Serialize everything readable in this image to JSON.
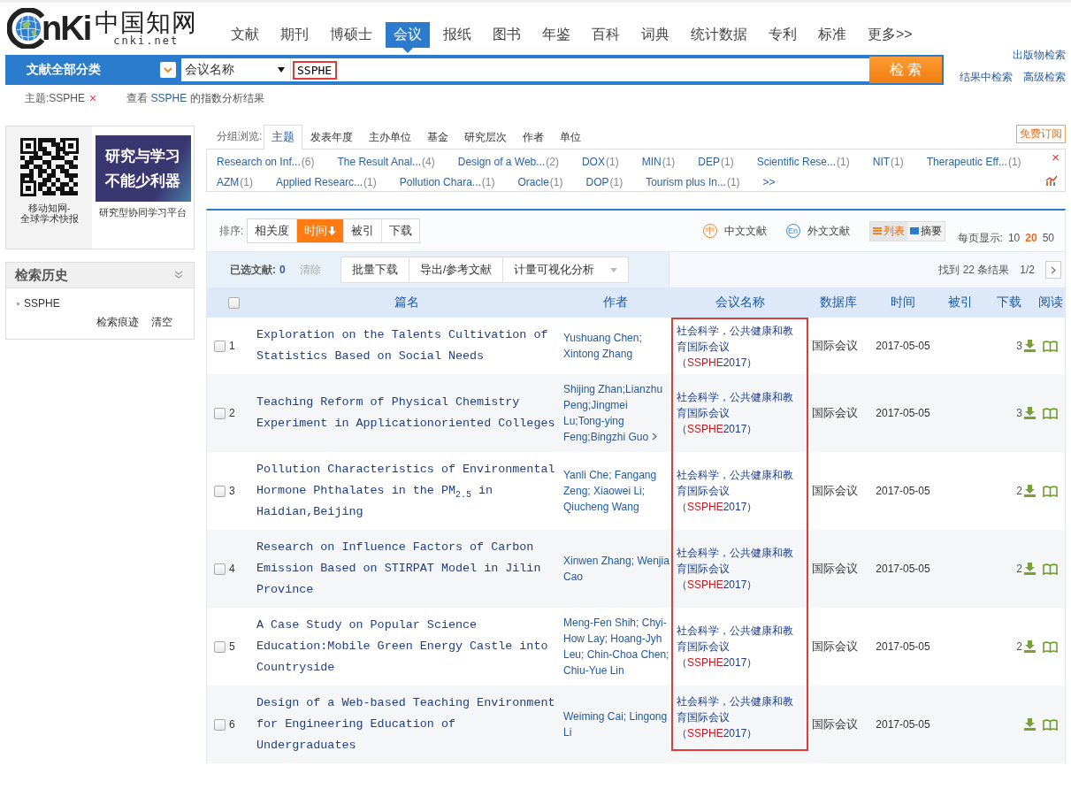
{
  "header": {
    "logo": {
      "mark": "nKi",
      "chinese": "中国知网",
      "domain": "cnki.net"
    },
    "nav": [
      {
        "label": "文献",
        "selected": false
      },
      {
        "label": "期刊",
        "selected": false
      },
      {
        "label": "博硕士",
        "selected": false
      },
      {
        "label": "会议",
        "selected": true
      },
      {
        "label": "报纸",
        "selected": false
      },
      {
        "label": "图书",
        "selected": false
      },
      {
        "label": "年鉴",
        "selected": false
      },
      {
        "label": "百科",
        "selected": false
      },
      {
        "label": "词典",
        "selected": false
      },
      {
        "label": "统计数据",
        "selected": false
      },
      {
        "label": "专利",
        "selected": false
      },
      {
        "label": "标准",
        "selected": false
      },
      {
        "label": "更多>>",
        "selected": false
      }
    ]
  },
  "search": {
    "category": "文献全部分类",
    "field": "会议名称",
    "query": "SSPHE",
    "query_highlighted": true,
    "button": "检 索",
    "links": [
      "出版物检索",
      "结果中检索",
      "高级检索"
    ]
  },
  "applied_filter": {
    "tag": "主题:SSPHE",
    "remove": "×",
    "analysis_prefix": "查看",
    "analysis_term": "SSPHE",
    "analysis_suffix": "的指数分析结果"
  },
  "sidebar": {
    "promo": {
      "qr_caption": [
        "移动知网-",
        "全球学术快报"
      ],
      "banner_lines": [
        "研究与学习",
        "不能少利器"
      ],
      "banner_caption": "研究型协同学习平台"
    },
    "history": {
      "title": "检索历史",
      "items": [
        "SSPHE"
      ],
      "actions": [
        "检索痕迹",
        "清空"
      ]
    }
  },
  "grouping": {
    "label": "分组浏览:",
    "tabs": [
      {
        "label": "主题",
        "selected": true
      },
      {
        "label": "发表年度",
        "selected": false
      },
      {
        "label": "主办单位",
        "selected": false
      },
      {
        "label": "基金",
        "selected": false
      },
      {
        "label": "研究层次",
        "selected": false
      },
      {
        "label": "作者",
        "selected": false
      },
      {
        "label": "单位",
        "selected": false
      }
    ],
    "subscribe": "免费订阅",
    "close": "×",
    "more": ">>",
    "items": [
      {
        "name": "Research on Inf...",
        "count": "(6)"
      },
      {
        "name": "The Result Anal...",
        "count": "(4)"
      },
      {
        "name": "Design of a Web...",
        "count": "(2)"
      },
      {
        "name": "DOX",
        "count": "(1)"
      },
      {
        "name": "MIN",
        "count": "(1)"
      },
      {
        "name": "DEP",
        "count": "(1)"
      },
      {
        "name": "Scientific Rese...",
        "count": "(1)"
      },
      {
        "name": "NIT",
        "count": "(1)"
      },
      {
        "name": "Therapeutic Eff...",
        "count": "(1)"
      },
      {
        "name": "AZM",
        "count": "(1)"
      },
      {
        "name": "Applied Researc...",
        "count": "(1)"
      },
      {
        "name": "Pollution Chara...",
        "count": "(1)"
      },
      {
        "name": "Oracle",
        "count": "(1)"
      },
      {
        "name": "DOP",
        "count": "(1)"
      },
      {
        "name": "Tourism plus In...",
        "count": "(1)"
      }
    ]
  },
  "results": {
    "sort": {
      "label": "排序:",
      "options": [
        {
          "label": "相关度",
          "selected": false
        },
        {
          "label": "时间",
          "selected": true
        },
        {
          "label": "被引",
          "selected": false
        },
        {
          "label": "下载",
          "selected": false
        }
      ]
    },
    "languages": [
      {
        "badge": "中",
        "label": "中文文献",
        "kind": "chinese"
      },
      {
        "badge": "En",
        "label": "外文文献",
        "kind": "foreign"
      }
    ],
    "views": [
      {
        "label": "列表",
        "selected": true,
        "kind": "list"
      },
      {
        "label": "摘要",
        "selected": false,
        "kind": "abstract"
      }
    ],
    "page_size": {
      "label": "每页显示:",
      "options": [
        {
          "label": "10",
          "selected": false
        },
        {
          "label": "20",
          "selected": true
        },
        {
          "label": "50",
          "selected": false
        }
      ]
    },
    "selection": {
      "label": "已选文献:",
      "count": "0",
      "clear": "清除",
      "actions": [
        {
          "label": "批量下载",
          "kind": "button"
        },
        {
          "label": "导出/参考文献",
          "kind": "button"
        },
        {
          "label": "计量可视化分析",
          "kind": "dropdown"
        }
      ]
    },
    "found": "找到 22 条结果",
    "page": "1/2",
    "select_all_checked": false,
    "conference_column_highlighted": true,
    "columns": [
      "篇名",
      "作者",
      "会议名称",
      "数据库",
      "时间",
      "被引",
      "下载",
      "阅读"
    ],
    "rows": [
      {
        "index": "1",
        "checked": false,
        "title": "Exploration on the Talents Cultivation of Statistics Based on Social Needs",
        "authors": "Yushuang Chen; Xintong Zhang",
        "authors_more": false,
        "conference": [
          {
            "text": "社会科学，公共健康和教育国际会议（",
            "hit": false
          },
          {
            "text": "SSPHE",
            "hit": true
          },
          {
            "text": "2017）",
            "hit": false
          }
        ],
        "database": "国际会议",
        "date": "2017-05-05",
        "downloads": "3"
      },
      {
        "index": "2",
        "checked": false,
        "title": "Teaching Reform of Physical Chemistry Experiment in Applicationoriented Colleges",
        "authors": "Shijing Zhan;Lianzhu Peng;Jingmei Lu;Tong-ying Feng;Bingzhi Guo",
        "authors_more": true,
        "conference": [
          {
            "text": "社会科学，公共健康和教育国际会议（",
            "hit": false
          },
          {
            "text": "SSPHE",
            "hit": true
          },
          {
            "text": "2017）",
            "hit": false
          }
        ],
        "database": "国际会议",
        "date": "2017-05-05",
        "downloads": "3"
      },
      {
        "index": "3",
        "checked": false,
        "title": "Pollution Characteristics of Environmental Hormone Phthalates in the PM$_{2.5}$ in Haidian,Beijing",
        "authors": "Yanli Che; Fangang Zeng; Xiaowei Li; Qiucheng Wang",
        "authors_more": false,
        "conference": [
          {
            "text": "社会科学，公共健康和教育国际会议（",
            "hit": false
          },
          {
            "text": "SSPHE",
            "hit": true
          },
          {
            "text": "2017）",
            "hit": false
          }
        ],
        "database": "国际会议",
        "date": "2017-05-05",
        "downloads": "2"
      },
      {
        "index": "4",
        "checked": false,
        "title": "Research on Influence Factors of Carbon Emission Based on STIRPAT Model in Jilin Province",
        "authors": "Xinwen Zhang; Wenjia Cao",
        "authors_more": false,
        "conference": [
          {
            "text": "社会科学，公共健康和教育国际会议（",
            "hit": false
          },
          {
            "text": "SSPHE",
            "hit": true
          },
          {
            "text": "2017）",
            "hit": false
          }
        ],
        "database": "国际会议",
        "date": "2017-05-05",
        "downloads": "2"
      },
      {
        "index": "5",
        "checked": false,
        "title": "A Case Study on Popular Science Education:Mobile Green Energy Castle into Countryside",
        "authors": "Meng-Fen Shih; Chyi-How Lay; Hoang-Jyh Leu; Chin-Choa Chen; Chiu-Yue Lin",
        "authors_more": false,
        "conference": [
          {
            "text": "社会科学，公共健康和教育国际会议（",
            "hit": false
          },
          {
            "text": "SSPHE",
            "hit": true
          },
          {
            "text": "2017）",
            "hit": false
          }
        ],
        "database": "国际会议",
        "date": "2017-05-05",
        "downloads": "2"
      },
      {
        "index": "6",
        "checked": false,
        "title": "Design of a Web-based Teaching Environment for Engineering Education of Undergraduates",
        "authors": "Weiming Cai; Lingong Li",
        "authors_more": false,
        "conference": [
          {
            "text": "社会科学，公共健康和教育国际会议（",
            "hit": false
          },
          {
            "text": "SSPHE",
            "hit": true
          },
          {
            "text": "2017）",
            "hit": false
          }
        ],
        "database": "国际会议",
        "date": "2017-05-05"
      }
    ]
  }
}
